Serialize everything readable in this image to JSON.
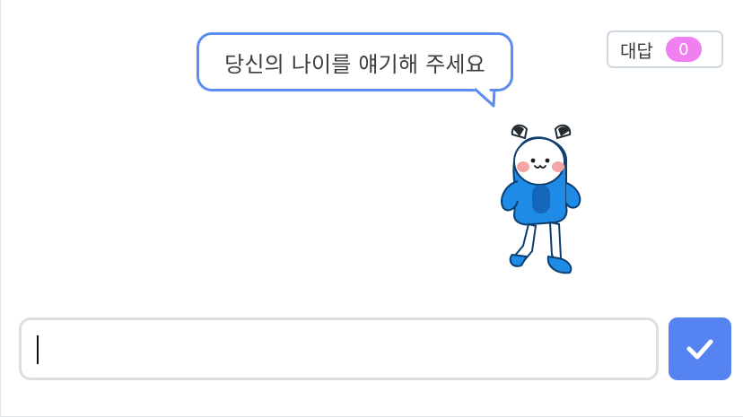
{
  "speech_bubble": {
    "text": "당신의 나이를 얘기해 주세요"
  },
  "answer_monitor": {
    "label": "대답",
    "value": "0"
  },
  "ask_prompt": {
    "input_value": "",
    "submit_icon": "check-icon"
  },
  "colors": {
    "bubble_border": "#5b8cf0",
    "monitor_badge": "#f07ff0",
    "submit_button": "#5583f1",
    "sprite_body": "#1e8be6"
  }
}
